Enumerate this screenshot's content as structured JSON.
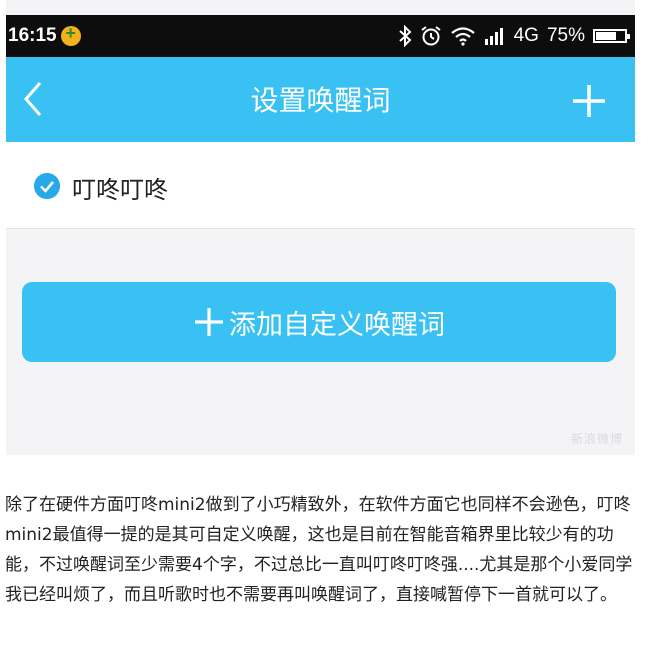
{
  "status_bar": {
    "time": "16:15",
    "network": "4G",
    "battery_percent": "75%",
    "battery_level": 0.75,
    "icons": [
      "notification-icon",
      "bluetooth-icon",
      "alarm-icon",
      "wifi-icon",
      "signal-icon",
      "battery-icon"
    ]
  },
  "app_bar": {
    "title": "设置唤醒词",
    "icons": {
      "back": "back-chevron-icon",
      "add": "plus-icon"
    },
    "background": "#38c1f2"
  },
  "wake_words": [
    {
      "label": "叮咚叮咚",
      "checked": true
    }
  ],
  "add_button": {
    "label": "添加自定义唤醒词"
  },
  "watermark": "新浪微博",
  "article": {
    "text": "除了在硬件方面叮咚mini2做到了小巧精致外，在软件方面它也同样不会逊色，叮咚mini2最值得一提的是其可自定义唤醒，这也是目前在智能音箱界里比较少有的功能，不过唤醒词至少需要4个字，不过总比一直叫叮咚叮咚强....尤其是那个小爱同学我已经叫烦了，而且听歌时也不需要再叫唤醒词了，直接喊暂停下一首就可以了。"
  },
  "colors": {
    "accent": "#38c1f2",
    "check": "#26a9e8",
    "statusbar": "#0d0d0d"
  }
}
